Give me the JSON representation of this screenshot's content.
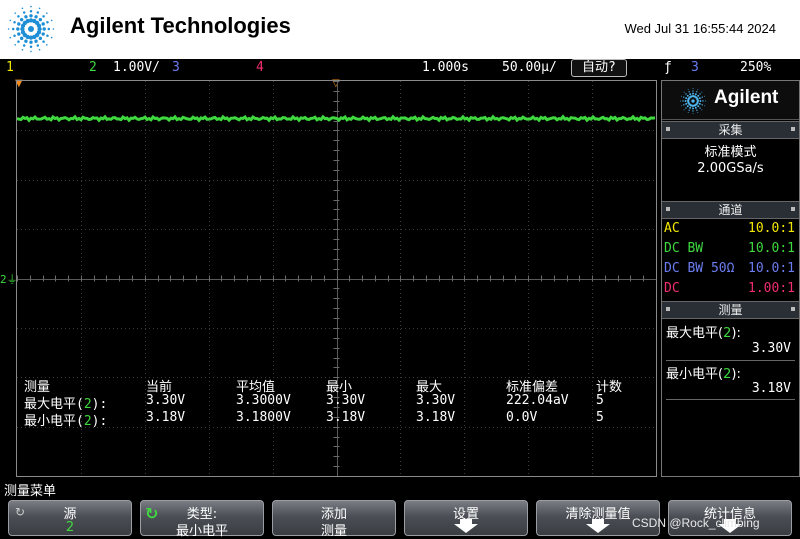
{
  "header": {
    "brand": "Agilent Technologies",
    "datetime": "Wed Jul 31 16:55:44 2024"
  },
  "status_bar": {
    "ch1_label": "1",
    "ch2_label": "2",
    "ch2_scale": "1.00V/",
    "ch3_label": "3",
    "ch4_label": "4",
    "time_delay": "1.000s",
    "time_scale": "50.00µ/",
    "run_mode": "自动?",
    "trigger_icon": "ƒ",
    "trigger_source": "3",
    "trigger_level": "250%"
  },
  "scope": {
    "ch2_ground_marker": "2⏚",
    "trace_color": "#3fd83f",
    "trace_level_fraction_from_top": 0.095
  },
  "measurements": {
    "headers": [
      "测量",
      "当前",
      "平均值",
      "最小",
      "最大",
      "标准偏差",
      "计数"
    ],
    "rows": [
      {
        "name": "最大电平",
        "channel": "2",
        "current": "3.30V",
        "mean": "3.3000V",
        "min": "3.30V",
        "max": "3.30V",
        "std": "222.04aV",
        "count": "5"
      },
      {
        "name": "最小电平",
        "channel": "2",
        "current": "3.18V",
        "mean": "3.1800V",
        "min": "3.18V",
        "max": "3.18V",
        "std": "0.0V",
        "count": "5"
      }
    ]
  },
  "right_panel": {
    "logo_word": "Agilent",
    "acquire_title": "采集",
    "acquire_mode": "标准模式",
    "sample_rate": "2.00GSa/s",
    "channel_title": "通道",
    "channels": [
      {
        "coupling": "AC",
        "probe": "10.0:1",
        "color": "#f2e600"
      },
      {
        "coupling": "DC BW",
        "probe": "10.0:1",
        "color": "#3fd83f"
      },
      {
        "coupling": "DC BW 50Ω",
        "probe": "10.0:1",
        "color": "#6b7cf0"
      },
      {
        "coupling": "DC",
        "probe": "1.00:1",
        "color": "#f02d6e"
      }
    ],
    "measure_title": "测量",
    "meas1_label": "最大电平",
    "meas1_channel": "2",
    "meas1_value": "3.30V",
    "meas2_label": "最小电平",
    "meas2_channel": "2",
    "meas2_value": "3.18V"
  },
  "menu": {
    "title": "测量菜单",
    "softkeys": [
      {
        "line1": "源",
        "line2": "2"
      },
      {
        "line1": "类型:",
        "line2": "最小电平"
      },
      {
        "line1": "添加",
        "line2": "测量"
      },
      {
        "line1": "设置",
        "line2": ""
      },
      {
        "line1": "清除测量值",
        "line2": ""
      },
      {
        "line1": "统计信息",
        "line2": ""
      }
    ]
  },
  "watermark": "CSDN @Rock_climbing"
}
